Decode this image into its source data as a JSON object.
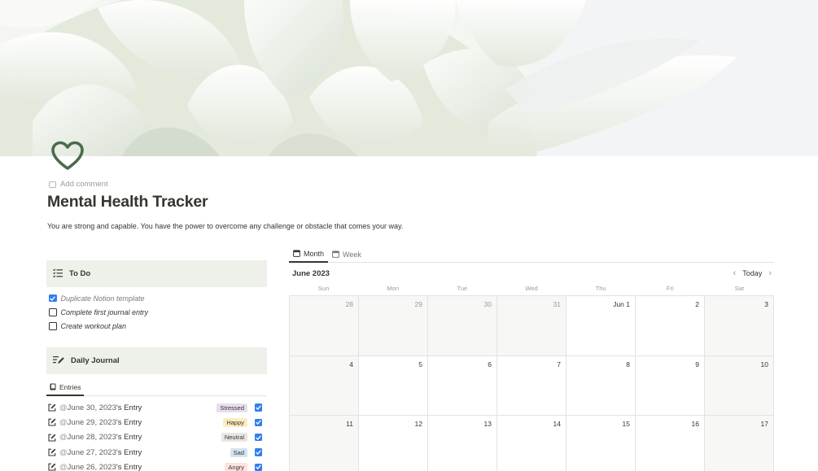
{
  "page": {
    "add_comment": "Add comment",
    "title": "Mental Health Tracker",
    "subtitle": "You are strong and capable. You have the power to overcome any challenge or obstacle that comes your way.",
    "icon": "heart-icon",
    "accent_color": "#4a6b4c"
  },
  "todo": {
    "heading": "To Do",
    "items": [
      {
        "label": "Duplicate Notion template",
        "checked": true
      },
      {
        "label": "Complete first journal entry",
        "checked": false
      },
      {
        "label": "Create workout plan",
        "checked": false
      }
    ]
  },
  "journal": {
    "heading": "Daily Journal",
    "tab": "Entries",
    "entries": [
      {
        "mention": "@",
        "date": "June 30, 2023",
        "suffix": "'s Entry",
        "mood": "Stressed",
        "mood_color": "#e8deee",
        "checked": true
      },
      {
        "mention": "@",
        "date": "June 29, 2023",
        "suffix": "'s Entry",
        "mood": "Happy",
        "mood_color": "#fbecc2",
        "checked": true
      },
      {
        "mention": "@",
        "date": "June 28, 2023",
        "suffix": "'s Entry",
        "mood": "Neutral",
        "mood_color": "#e9e5e3",
        "checked": true
      },
      {
        "mention": "@",
        "date": "June 27, 2023",
        "suffix": "'s Entry",
        "mood": "Sad",
        "mood_color": "#d3e5ef",
        "checked": true
      },
      {
        "mention": "@",
        "date": "June 26, 2023",
        "suffix": "'s Entry",
        "mood": "Angry",
        "mood_color": "#ffe2dd",
        "checked": true
      }
    ]
  },
  "calendar": {
    "tabs": {
      "month": "Month",
      "week": "Week"
    },
    "month_label": "June 2023",
    "today_label": "Today",
    "prev_icon": "‹",
    "next_icon": "›",
    "weekdays": [
      "Sun",
      "Mon",
      "Tue",
      "Wed",
      "Thu",
      "Fri",
      "Sat"
    ],
    "weeks": [
      [
        "28",
        "29",
        "30",
        "31",
        "Jun 1",
        "2",
        "3"
      ],
      [
        "4",
        "5",
        "6",
        "7",
        "8",
        "9",
        "10"
      ],
      [
        "11",
        "12",
        "13",
        "14",
        "15",
        "16",
        "17"
      ]
    ]
  }
}
